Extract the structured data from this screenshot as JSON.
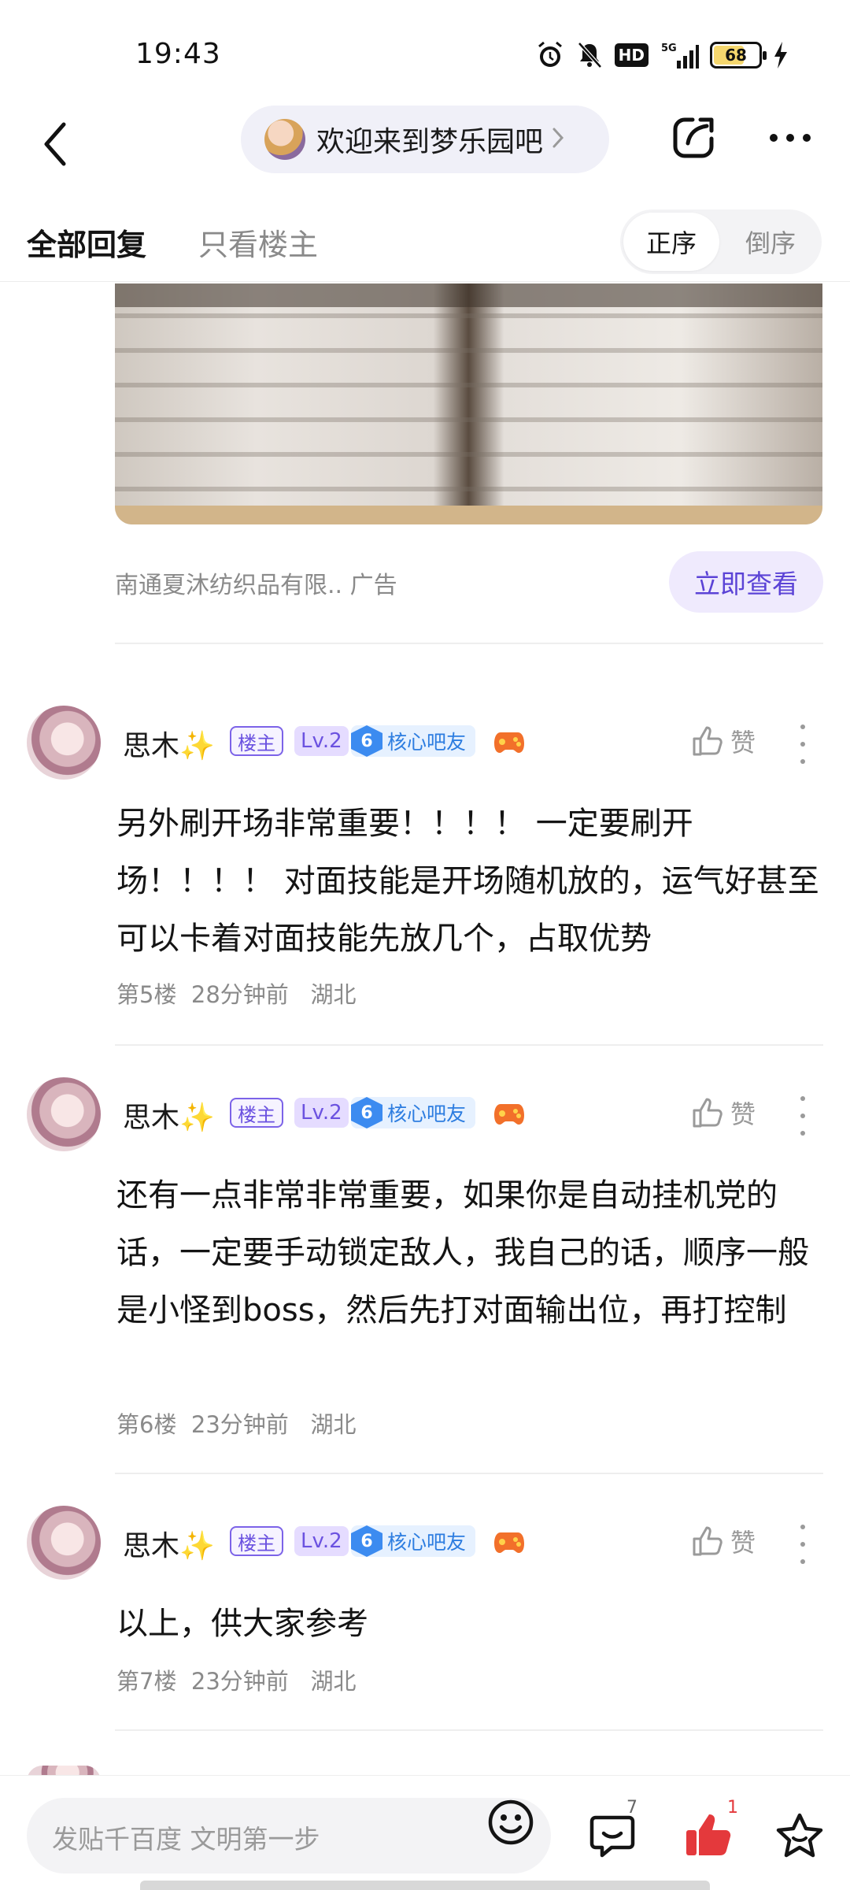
{
  "status_bar": {
    "time": "19:43",
    "network": "5G",
    "hd": "HD",
    "battery": "68",
    "battery_level": 0.68
  },
  "nav": {
    "forum_title": "欢迎来到梦乐园吧",
    "icons": [
      "back-arrow-icon",
      "chevron-right-icon",
      "share-icon",
      "more-horizontal-icon"
    ]
  },
  "tabs": {
    "all_replies": "全部回复",
    "host_only": "只看楼主",
    "sort_asc": "正序",
    "sort_desc": "倒序"
  },
  "ad": {
    "source": "南通夏沐纺织品有限.. 广告",
    "cta": "立即查看"
  },
  "posts": [
    {
      "username": "思木✨",
      "badge_host": "楼主",
      "badge_level": "Lv.2",
      "member_level": "6",
      "member_label": "核心吧友",
      "like_label": "赞",
      "text": "另外刷开场非常重要！！！！ 一定要刷开场！！！！ 对面技能是开场随机放的，运气好甚至可以卡着对面技能先放几个，占取优势",
      "floor": "第5楼",
      "time": "28分钟前",
      "location": "湖北"
    },
    {
      "username": "思木✨",
      "badge_host": "楼主",
      "badge_level": "Lv.2",
      "member_level": "6",
      "member_label": "核心吧友",
      "like_label": "赞",
      "text": "还有一点非常非常重要，如果你是自动挂机党的话，一定要手动锁定敌人，我自己的话，顺序一般是小怪到boss，然后先打对面输出位，再打控制",
      "floor": "第6楼",
      "time": "23分钟前",
      "location": "湖北"
    },
    {
      "username": "思木✨",
      "badge_host": "楼主",
      "badge_level": "Lv.2",
      "member_level": "6",
      "member_label": "核心吧友",
      "like_label": "赞",
      "text": "以上，供大家参考",
      "floor": "第7楼",
      "time": "23分钟前",
      "location": "湖北"
    }
  ],
  "bottom_bar": {
    "input_placeholder": "发贴千百度 文明第一步",
    "comment_count": "7",
    "like_count": "1"
  },
  "colors": {
    "accent": "#6b52e0",
    "cta_bg": "#efeafd",
    "like_red": "#e4393c",
    "member_blue": "#2d7de0"
  }
}
